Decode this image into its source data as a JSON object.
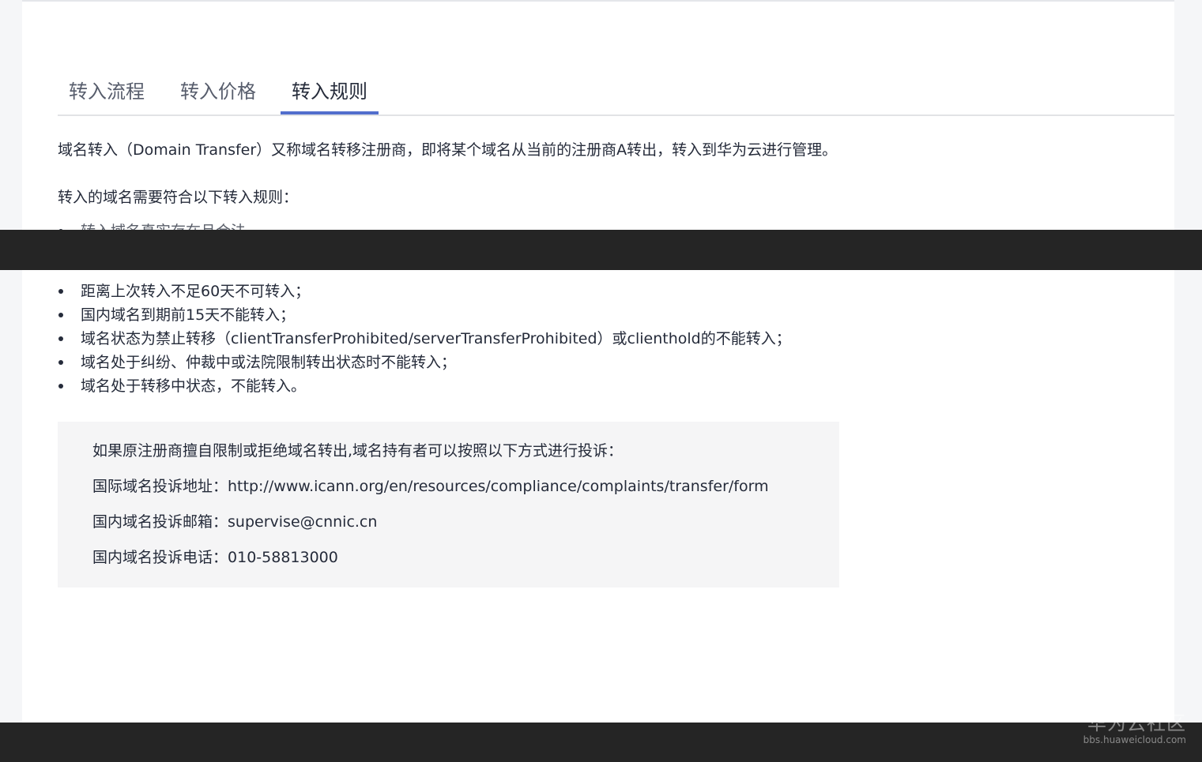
{
  "tabs": [
    {
      "label": "转入流程"
    },
    {
      "label": "转入价格"
    },
    {
      "label": "转入规则",
      "active": true
    }
  ],
  "intro": "域名转入（Domain Transfer）又称域名转移注册商，即将某个域名从当前的注册商A转出，转入到华为云进行管理。",
  "rules_title": "转入的域名需要符合以下转入规则：",
  "rules": [
    "转入域名真实存在且合法",
    "距离上次转入不足60天不可转入；",
    "国内域名到期前15天不能转入；",
    "域名状态为禁止转移（clientTransferProhibited/serverTransferProhibited）或clienthold的不能转入；",
    "域名处于纠纷、仲裁中或法院限制转出状态时不能转入；",
    "域名处于转移中状态，不能转入。"
  ],
  "notice": {
    "title": "如果原注册商擅自限制或拒绝域名转出,域名持有者可以按照以下方式进行投诉：",
    "intl_label": "国际域名投诉地址：",
    "intl_value": "http://www.icann.org/en/resources/compliance/complaints/transfer/form",
    "email_label": "国内域名投诉邮箱：",
    "email_value": "supervise@cnnic.cn",
    "phone_label": "国内域名投诉电话：",
    "phone_value": "010-58813000"
  },
  "watermark": {
    "logo": "华为云社区",
    "url": "bbs.huaweicloud.com"
  },
  "colors": {
    "accent": "#526ecc",
    "text": "#252b3a",
    "tab_inactive": "#575d6c",
    "notice_bg": "#f5f5f6",
    "overlay": "#252525"
  }
}
